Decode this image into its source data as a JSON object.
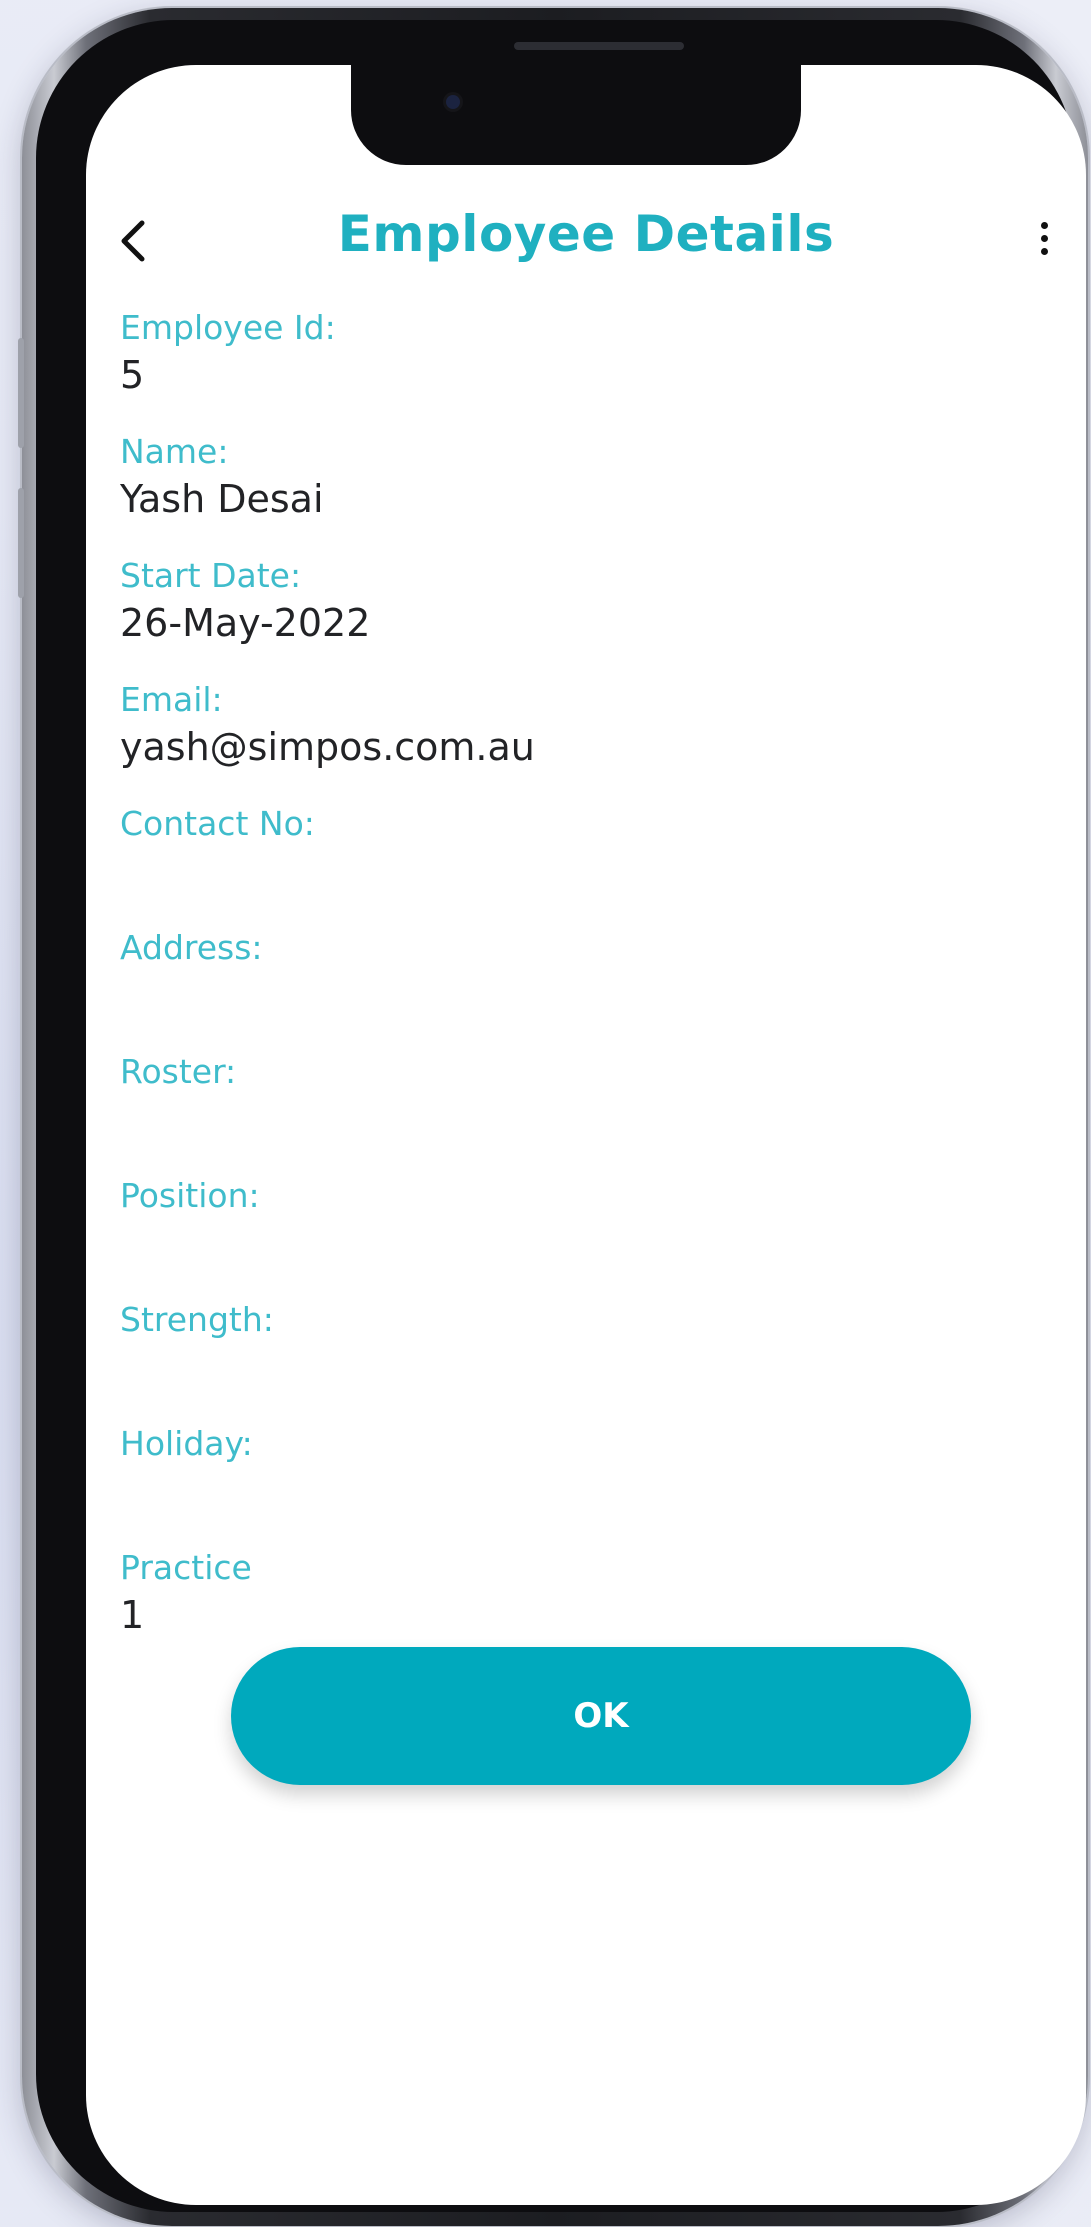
{
  "header": {
    "title": "Employee Details",
    "back_icon": "chevron-left-icon",
    "menu_icon": "more-vertical-icon"
  },
  "fields": [
    {
      "label": "Employee Id:",
      "value": "5"
    },
    {
      "label": "Name:",
      "value": "Yash Desai"
    },
    {
      "label": "Start Date:",
      "value": "26-May-2022"
    },
    {
      "label": "Email:",
      "value": "yash@simpos.com.au"
    },
    {
      "label": "Contact No:",
      "value": ""
    },
    {
      "label": "Address:",
      "value": ""
    },
    {
      "label": "Roster:",
      "value": ""
    },
    {
      "label": "Position:",
      "value": ""
    },
    {
      "label": "Strength:",
      "value": ""
    },
    {
      "label": "Holiday:",
      "value": ""
    },
    {
      "label": "Practice",
      "value": "1"
    }
  ],
  "actions": {
    "ok_label": "OK"
  },
  "colors": {
    "accent": "#1fb0c0",
    "label": "#3fbccb",
    "button": "#00a9bd",
    "value_text": "#222326"
  }
}
